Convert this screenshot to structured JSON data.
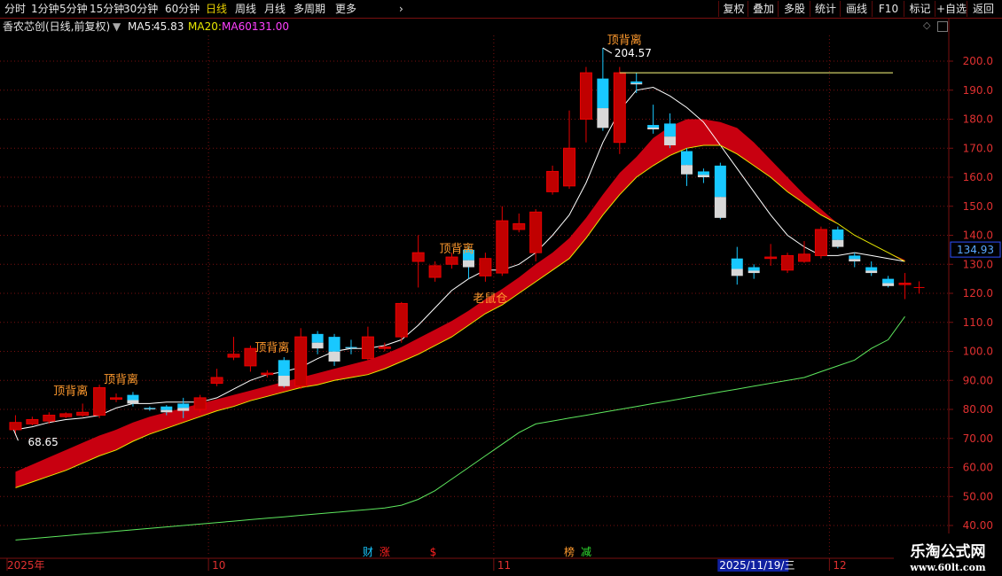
{
  "toolbar": {
    "left_items": [
      {
        "label": "分时",
        "active": false
      },
      {
        "label": "1分钟",
        "active": false
      },
      {
        "label": "5分钟",
        "active": false
      },
      {
        "label": "15分钟",
        "active": false
      },
      {
        "label": "30分钟",
        "active": false
      },
      {
        "label": "60分钟",
        "active": false
      },
      {
        "label": "日线",
        "active": true
      },
      {
        "label": "周线",
        "active": false
      },
      {
        "label": "月线",
        "active": false
      },
      {
        "label": "多周期",
        "active": false
      },
      {
        "label": "更多",
        "active": false
      }
    ],
    "right_items": [
      "复权",
      "叠加",
      "多股",
      "统计",
      "画线",
      "F10",
      "标记",
      "+自选",
      "返回"
    ]
  },
  "info": {
    "title": "香农芯创(日线,前复权)",
    "ma5_label": "MA5:",
    "ma5_value": "45.83",
    "ma20_label": "MA20:",
    "ma60_label": "MA60:",
    "ma60_value": "131.00"
  },
  "colors": {
    "up": "#e80000",
    "down": "#18c8ff",
    "ma5": "#ffffff",
    "ma20": "#e8e800",
    "ma60": "#5ee85e",
    "ribbon_up": "#c80010",
    "ribbon_down": "#08b008",
    "grid": "#7a1010",
    "axis_text": "#e03030",
    "label": "#ff9a2e"
  },
  "chart_data": {
    "type": "candlestick",
    "ylim": [
      35,
      210
    ],
    "y_ticks": [
      "200.0",
      "190.0",
      "180.0",
      "170.0",
      "160.0",
      "150.0",
      "140.0",
      "130.0",
      "120.0",
      "110.0",
      "100.0",
      "90.00",
      "80.00",
      "70.00",
      "60.00",
      "50.00",
      "40.00"
    ],
    "y_tick_values": [
      200,
      190,
      180,
      170,
      160,
      150,
      140,
      130,
      120,
      110,
      100,
      90,
      80,
      70,
      60,
      50,
      40
    ],
    "x_labels": [
      {
        "label": "2025年",
        "index": 0
      },
      {
        "label": "10",
        "index": 12
      },
      {
        "label": "11",
        "index": 29
      },
      {
        "label": "12",
        "index": 49
      }
    ],
    "cursor_date": "2025/11/19/三",
    "cursor_index": 43,
    "current_price": "134.93",
    "current_value": 134.93,
    "high_label": "204.57",
    "high_value": 204.57,
    "high_index": 35,
    "low_label": "68.65",
    "low_value": 68.65,
    "low_index": 0,
    "signals": [
      {
        "text": "顶背离",
        "index": 3,
        "value": 85
      },
      {
        "text": "顶背离",
        "index": 6,
        "value": 89
      },
      {
        "text": "顶背离",
        "index": 15,
        "value": 100
      },
      {
        "text": "顶背离",
        "index": 26,
        "value": 134
      },
      {
        "text": "老鼠仓",
        "index": 28,
        "value": 117
      },
      {
        "text": "顶背离",
        "index": 36,
        "value": 206
      }
    ],
    "event_markers": [
      {
        "text": "财",
        "index": 21,
        "color": "#18c8ff"
      },
      {
        "text": "涨",
        "index": 22,
        "color": "#ff2020"
      },
      {
        "text": "$",
        "index": 25,
        "color": "#ff2020"
      },
      {
        "text": "榜",
        "index": 33,
        "color": "#ff9a2e"
      },
      {
        "text": "减",
        "index": 34,
        "color": "#30e030"
      }
    ],
    "candles": [
      {
        "o": 73.0,
        "c": 75.5,
        "h": 78.0,
        "l": 71.0
      },
      {
        "o": 75.0,
        "c": 76.5,
        "h": 77.5,
        "l": 74.5
      },
      {
        "o": 76.0,
        "c": 78.0,
        "h": 79.0,
        "l": 75.0
      },
      {
        "o": 77.5,
        "c": 78.5,
        "h": 79.0,
        "l": 77.0
      },
      {
        "o": 78.0,
        "c": 79.0,
        "h": 82.0,
        "l": 77.5
      },
      {
        "o": 78.0,
        "c": 87.5,
        "h": 88.5,
        "l": 77.0
      },
      {
        "o": 83.5,
        "c": 84.0,
        "h": 85.5,
        "l": 82.5
      },
      {
        "o": 85.0,
        "c": 82.0,
        "h": 86.0,
        "l": 81.0
      },
      {
        "o": 80.5,
        "c": 80.0,
        "h": 81.0,
        "l": 79.5
      },
      {
        "o": 81.0,
        "c": 79.0,
        "h": 81.5,
        "l": 78.0
      },
      {
        "o": 82.0,
        "c": 79.5,
        "h": 84.0,
        "l": 77.0
      },
      {
        "o": 80.0,
        "c": 84.0,
        "h": 85.0,
        "l": 79.0
      },
      {
        "o": 89.0,
        "c": 91.0,
        "h": 94.0,
        "l": 88.0
      },
      {
        "o": 98.0,
        "c": 99.0,
        "h": 105.0,
        "l": 97.0
      },
      {
        "o": 95.0,
        "c": 101.0,
        "h": 102.0,
        "l": 93.0
      },
      {
        "o": 92.0,
        "c": 92.5,
        "h": 93.5,
        "l": 91.0
      },
      {
        "o": 97.0,
        "c": 88.0,
        "h": 98.0,
        "l": 87.5
      },
      {
        "o": 88.0,
        "c": 105.0,
        "h": 108.0,
        "l": 87.0
      },
      {
        "o": 106.0,
        "c": 101.0,
        "h": 107.0,
        "l": 99.0
      },
      {
        "o": 105.0,
        "c": 96.5,
        "h": 106.0,
        "l": 95.0
      },
      {
        "o": 101.5,
        "c": 101.0,
        "h": 104.0,
        "l": 99.0
      },
      {
        "o": 97.5,
        "c": 105.0,
        "h": 108.5,
        "l": 97.0
      },
      {
        "o": 101.0,
        "c": 101.5,
        "h": 103.0,
        "l": 100.0
      },
      {
        "o": 105.0,
        "c": 116.5,
        "h": 117.0,
        "l": 103.0
      },
      {
        "o": 131.0,
        "c": 134.0,
        "h": 140.0,
        "l": 122.0
      },
      {
        "o": 125.5,
        "c": 129.5,
        "h": 131.0,
        "l": 124.0
      },
      {
        "o": 130.0,
        "c": 132.5,
        "h": 134.0,
        "l": 128.5
      },
      {
        "o": 135.0,
        "c": 129.0,
        "h": 136.0,
        "l": 125.0
      },
      {
        "o": 126.0,
        "c": 132.0,
        "h": 134.0,
        "l": 124.0
      },
      {
        "o": 127.0,
        "c": 145.0,
        "h": 150.0,
        "l": 126.0
      },
      {
        "o": 142.0,
        "c": 144.0,
        "h": 147.5,
        "l": 141.0
      },
      {
        "o": 134.0,
        "c": 148.0,
        "h": 149.0,
        "l": 131.0
      },
      {
        "o": 155.0,
        "c": 162.0,
        "h": 164.0,
        "l": 154.0
      },
      {
        "o": 157.0,
        "c": 170.0,
        "h": 183.0,
        "l": 156.0
      },
      {
        "o": 180.0,
        "c": 196.0,
        "h": 198.0,
        "l": 172.0
      },
      {
        "o": 194.0,
        "c": 177.0,
        "h": 204.57,
        "l": 176.0
      },
      {
        "o": 172.0,
        "c": 196.0,
        "h": 198.0,
        "l": 168.0
      },
      {
        "o": 193.0,
        "c": 192.0,
        "h": 196.0,
        "l": 189.0
      },
      {
        "o": 178.0,
        "c": 176.5,
        "h": 185.0,
        "l": 175.0
      },
      {
        "o": 178.5,
        "c": 171.0,
        "h": 182.0,
        "l": 170.0
      },
      {
        "o": 169.0,
        "c": 161.0,
        "h": 170.0,
        "l": 157.0
      },
      {
        "o": 162.0,
        "c": 160.0,
        "h": 163.0,
        "l": 158.0
      },
      {
        "o": 164.0,
        "c": 146.0,
        "h": 165.0,
        "l": 145.5
      },
      {
        "o": 132.0,
        "c": 126.0,
        "h": 136.0,
        "l": 123.0
      },
      {
        "o": 129.0,
        "c": 127.0,
        "h": 130.0,
        "l": 125.0
      },
      {
        "o": 132.0,
        "c": 132.5,
        "h": 137.0,
        "l": 129.5
      },
      {
        "o": 128.0,
        "c": 133.0,
        "h": 134.0,
        "l": 127.0
      },
      {
        "o": 131.0,
        "c": 133.5,
        "h": 138.0,
        "l": 130.5
      },
      {
        "o": 133.0,
        "c": 142.0,
        "h": 143.0,
        "l": 132.0
      },
      {
        "o": 142.0,
        "c": 136.0,
        "h": 143.0,
        "l": 135.5
      },
      {
        "o": 133.0,
        "c": 131.0,
        "h": 134.0,
        "l": 129.0
      },
      {
        "o": 129.0,
        "c": 127.0,
        "h": 131.0,
        "l": 126.0
      },
      {
        "o": 125.0,
        "c": 122.5,
        "h": 126.0,
        "l": 122.0
      },
      {
        "o": 123.0,
        "c": 123.5,
        "h": 127.0,
        "l": 118.0
      }
    ],
    "series": [
      {
        "name": "MA5",
        "color": "#ffffff",
        "values": [
          73,
          74,
          75.5,
          76.5,
          77,
          78,
          80.5,
          82,
          82,
          82.5,
          82.5,
          82.5,
          84,
          87,
          90,
          92,
          93,
          94.5,
          97.5,
          100,
          101,
          101,
          102,
          104,
          109,
          115,
          121,
          125,
          128,
          128,
          130,
          134,
          140,
          147,
          158,
          172,
          183,
          190,
          191,
          188,
          184,
          179,
          171,
          163,
          155,
          147,
          140,
          136,
          133,
          133,
          134,
          133,
          132,
          131
        ]
      },
      {
        "name": "MA20",
        "color": "#e8e800",
        "values": [
          53,
          55,
          57,
          59,
          61.5,
          64,
          66,
          69,
          71.5,
          73.5,
          75.5,
          77.5,
          79.5,
          81,
          83,
          84.5,
          86,
          87.5,
          88.5,
          90,
          91,
          92,
          94,
          96.5,
          99,
          102,
          105,
          109,
          113,
          116,
          120,
          124,
          128,
          132,
          139,
          147,
          154,
          160,
          164,
          167.5,
          170,
          171,
          171,
          168,
          164,
          160,
          155,
          151,
          147,
          144,
          140,
          137,
          134,
          131
        ]
      },
      {
        "name": "MA60",
        "color": "#5ee85e",
        "values": [
          35,
          35.5,
          36,
          36.5,
          37,
          37.5,
          38,
          38.5,
          39,
          39.5,
          40,
          40.5,
          41,
          41.5,
          42,
          42.5,
          43,
          43.5,
          44,
          44.5,
          45,
          45.5,
          46,
          47,
          49,
          52,
          56,
          60,
          64,
          68,
          72,
          75,
          76,
          77,
          78,
          79,
          80,
          81,
          82,
          83,
          84,
          85,
          86,
          87,
          88,
          89,
          90,
          91,
          93,
          95,
          97,
          101,
          104,
          112
        ]
      },
      {
        "name": "ribbon_upper",
        "values": [
          58.5,
          61,
          63.5,
          66,
          68.5,
          71,
          73,
          75.5,
          77.5,
          79,
          80.5,
          82,
          83.5,
          85,
          86.5,
          88,
          89.5,
          91,
          92.5,
          94,
          95.5,
          97,
          99,
          101.5,
          104.5,
          107.5,
          110.5,
          114,
          118,
          121.5,
          125.5,
          130,
          134,
          139,
          146,
          154,
          161.5,
          167,
          173.5,
          177.5,
          180,
          180,
          179,
          177,
          172,
          166,
          160,
          154,
          149,
          144,
          140,
          137,
          134,
          131.5
        ]
      },
      {
        "name": "ribbon_lower",
        "values": [
          53,
          55,
          57,
          59,
          61.5,
          64,
          66,
          69,
          71.5,
          73.5,
          75.5,
          77.5,
          79.5,
          81,
          83,
          84.5,
          86,
          87.5,
          88.5,
          90,
          91,
          92,
          94,
          96.5,
          99,
          102,
          105,
          109,
          113,
          116,
          120,
          124,
          128,
          132,
          139,
          147,
          154,
          160,
          164,
          167.5,
          170,
          171,
          171,
          168,
          164,
          160,
          155,
          151,
          147,
          144,
          140,
          137,
          134,
          131
        ]
      }
    ]
  }
}
